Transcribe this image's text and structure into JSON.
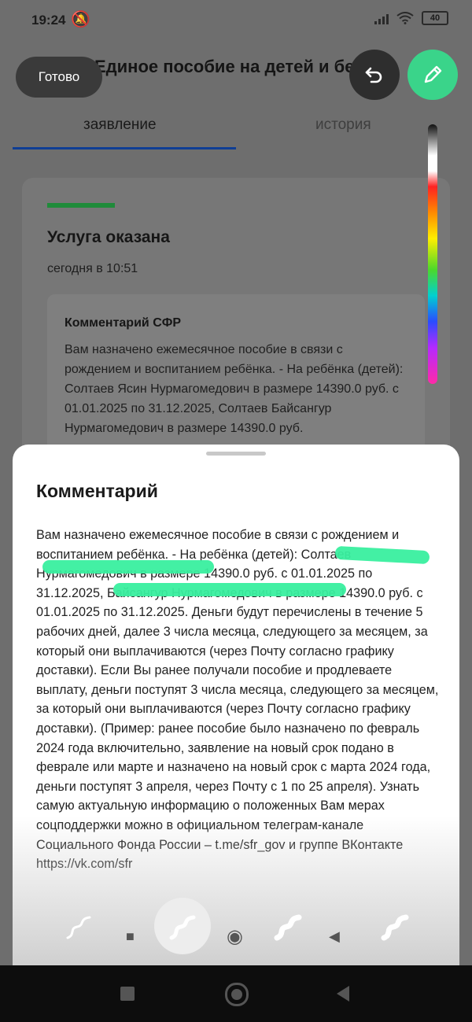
{
  "status_bar": {
    "time": "19:24",
    "battery": "40"
  },
  "header": {
    "title": "Единое пособие на детей и бер..."
  },
  "buttons": {
    "done": "Готово"
  },
  "tabs": [
    {
      "label": "заявление"
    },
    {
      "label": "история"
    }
  ],
  "card": {
    "status_title": "Услуга оказана",
    "status_date": "сегодня в 10:51",
    "comment_title": "Комментарий СФР",
    "comment_text": "Вам назначено ежемесячное пособие в связи с рождением и воспитанием ребёнка. - На ребёнка (детей): Солтаев Ясин Нурмагомедович в размере 14390.0 руб. с 01.01.2025 по 31.12.2025, Солтаев Байсангур Нурмагомедович в размере 14390.0 руб."
  },
  "sheet": {
    "title": "Комментарий",
    "text": "Вам назначено ежемесячное пособие в связи с рождением и воспитанием ребёнка. - На ребёнка (детей): Солтаев Нурмагомедович в размере 14390.0 руб. с 01.01.2025 по 31.12.2025, Байсангур Нурмагомедович в размере 14390.0 руб. с 01.01.2025 по 31.12.2025. Деньги будут перечислены в течение 5 рабочих дней, далее 3 числа месяца, следующего за месяцем, за который они выплачиваются (через Почту согласно графику доставки). Если Вы ранее получали пособие и продлеваете выплату, деньги поступят 3 числа месяца, следующего за месяцем, за который они выплачиваются (через Почту согласно графику доставки). (Пример: ранее пособие было назначено по февраль 2024 года включительно, заявление на новый срок подано в феврале или марте и назначено на новый срок с марта 2024 года, деньги поступят 3 апреля, через Почту с 1 по 25 апреля). Узнать самую актуальную информацию о положенных Вам мерах соцподдержки можно в официальном телеграм-канале Социального Фонда России – t.me/sfr_gov и группе ВКонтакте https://vk.com/sfr"
  },
  "colors": {
    "accent_green": "#3ad48a",
    "marker": "#39ef9f",
    "tab_underline": "#0f3e94",
    "status_accent": "#1f8b3a"
  },
  "icons": {
    "back": "arrow-left-icon",
    "undo": "undo-icon",
    "pen": "pen-icon",
    "brushes": [
      "brush-thin-icon",
      "brush-medium-icon",
      "brush-thick-icon",
      "brush-pattern-icon"
    ],
    "nav": [
      "recents-icon",
      "home-icon",
      "back-icon"
    ]
  }
}
